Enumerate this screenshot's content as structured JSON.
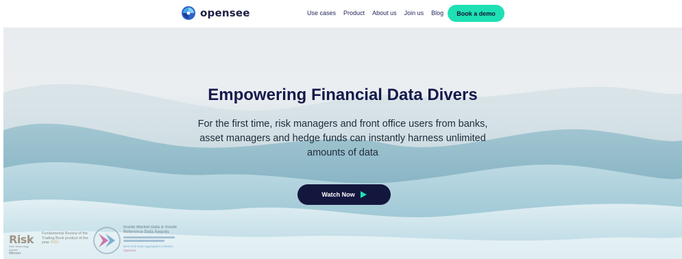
{
  "nav": {
    "logo_text": "opensee",
    "links": [
      "Use cases",
      "Product",
      "About us",
      "Join us",
      "Blog"
    ],
    "cta": "Book a demo",
    "colors": {
      "cta": "#1ee0b4",
      "text": "#24265a"
    }
  },
  "hero": {
    "title": "Empowering Financial Data Divers",
    "subtitle": "For the first time, risk managers and front office users from banks, asset managers and hedge funds can instantly harness unlimited amounts of data",
    "watch_button": "Watch Now",
    "play_icon": "play-icon",
    "colors": {
      "title": "#16194a",
      "button": "#14173d",
      "play": "#1ee0b4"
    }
  },
  "awards": {
    "risk": {
      "logo": "Risk",
      "tagline": "Risk Technology Awards",
      "status": "Winner",
      "description": "Fundamental Review of the Trading Book product of the year",
      "year": "2020"
    },
    "inside": {
      "title": "Inside Market Data & Inside Reference Data Awards",
      "category": "Best Risk Data Aggregation Initiative",
      "brand": "Opensee"
    }
  }
}
